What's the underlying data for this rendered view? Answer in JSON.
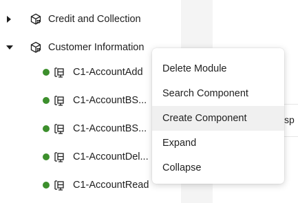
{
  "tree": {
    "modules": [
      {
        "label": "Credit and Collection",
        "expanded": false,
        "icon": "module-icon"
      },
      {
        "label": "Customer Information",
        "expanded": true,
        "icon": "module-icon"
      }
    ],
    "components": [
      {
        "label": "C1-AccountAdd",
        "status_color": "#3c8f2c",
        "icon": "component-icon"
      },
      {
        "label": "C1-AccountBS...",
        "status_color": "#3c8f2c",
        "icon": "component-icon"
      },
      {
        "label": "C1-AccountBS...",
        "status_color": "#3c8f2c",
        "icon": "component-icon"
      },
      {
        "label": "C1-AccountDel...",
        "status_color": "#3c8f2c",
        "icon": "component-icon"
      },
      {
        "label": "C1-AccountRead",
        "status_color": "#3c8f2c",
        "icon": "component-icon"
      }
    ]
  },
  "context_menu": {
    "items": [
      {
        "label": "Delete Module"
      },
      {
        "label": "Search Component"
      },
      {
        "label": "Create Component",
        "highlighted": true
      },
      {
        "label": "Expand"
      },
      {
        "label": "Collapse"
      }
    ]
  },
  "background_peek_text": "sp",
  "colors": {
    "status_green": "#3c8f2c",
    "menu_hover": "#f0f0f0",
    "strip_gray": "#f4f4f4"
  }
}
